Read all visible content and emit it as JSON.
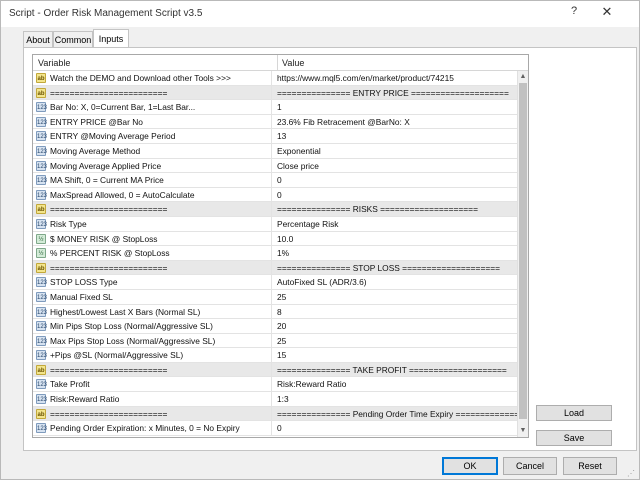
{
  "window": {
    "title": "Script - Order Risk Management Script v3.5",
    "help_glyph": "?",
    "close_glyph": "✕"
  },
  "tabs": [
    {
      "label": "About",
      "active": false
    },
    {
      "label": "Common",
      "active": false
    },
    {
      "label": "Inputs",
      "active": true
    }
  ],
  "grid": {
    "headers": {
      "variable": "Variable",
      "value": "Value"
    },
    "rows": [
      {
        "icon": "ab",
        "variable": "Watch the DEMO and Download other Tools >>>",
        "value": "https://www.mql5.com/en/market/product/74215",
        "sep": false
      },
      {
        "icon": "ab",
        "variable": "========================",
        "value": "=============== ENTRY PRICE ====================",
        "sep": true
      },
      {
        "icon": "123",
        "variable": "Bar No: X, 0=Current Bar, 1=Last Bar...",
        "value": "1",
        "sep": false
      },
      {
        "icon": "123",
        "variable": "ENTRY PRICE @Bar No",
        "value": "23.6% Fib Retracement @BarNo: X",
        "sep": false
      },
      {
        "icon": "123",
        "variable": "ENTRY @Moving Average Period",
        "value": "13",
        "sep": false
      },
      {
        "icon": "123",
        "variable": "Moving Average Method",
        "value": "Exponential",
        "sep": false
      },
      {
        "icon": "123",
        "variable": "Moving Average Applied Price",
        "value": "Close price",
        "sep": false
      },
      {
        "icon": "123",
        "variable": "MA Shift, 0 = Current MA Price",
        "value": "0",
        "sep": false
      },
      {
        "icon": "123",
        "variable": "MaxSpread Allowed, 0 = AutoCalculate",
        "value": "0",
        "sep": false
      },
      {
        "icon": "ab",
        "variable": "========================",
        "value": "=============== RISKS ====================",
        "sep": true
      },
      {
        "icon": "123",
        "variable": "Risk Type",
        "value": "Percentage Risk",
        "sep": false
      },
      {
        "icon": "half",
        "variable": "$ MONEY RISK @ StopLoss",
        "value": "10.0",
        "sep": false
      },
      {
        "icon": "half",
        "variable": "% PERCENT RISK @ StopLoss",
        "value": "1%",
        "sep": false
      },
      {
        "icon": "ab",
        "variable": "========================",
        "value": "=============== STOP LOSS ====================",
        "sep": true
      },
      {
        "icon": "123",
        "variable": "STOP LOSS Type",
        "value": "AutoFixed SL (ADR/3.6)",
        "sep": false
      },
      {
        "icon": "123",
        "variable": "Manual Fixed SL",
        "value": "25",
        "sep": false
      },
      {
        "icon": "123",
        "variable": "Highest/Lowest Last X Bars (Normal SL)",
        "value": "8",
        "sep": false
      },
      {
        "icon": "123",
        "variable": "Min Pips Stop Loss (Normal/Aggressive SL)",
        "value": "20",
        "sep": false
      },
      {
        "icon": "123",
        "variable": "Max Pips Stop Loss (Normal/Aggressive SL)",
        "value": "25",
        "sep": false
      },
      {
        "icon": "123",
        "variable": "+Pips @SL (Normal/Aggressive SL)",
        "value": "15",
        "sep": false
      },
      {
        "icon": "ab",
        "variable": "========================",
        "value": "=============== TAKE PROFIT ====================",
        "sep": true
      },
      {
        "icon": "123",
        "variable": "Take Profit",
        "value": "Risk:Reward Ratio",
        "sep": false
      },
      {
        "icon": "123",
        "variable": "Risk:Reward Ratio",
        "value": "1:3",
        "sep": false
      },
      {
        "icon": "ab",
        "variable": "========================",
        "value": "=============== Pending Order Time Expiry ===============...",
        "sep": true
      },
      {
        "icon": "123",
        "variable": "Pending Order Expiration: x Minutes, 0 = No Expiry",
        "value": "0",
        "sep": false
      }
    ]
  },
  "icons": {
    "ab": "ab",
    "123": "123",
    "half": "½"
  },
  "scroll": {
    "up_glyph": "▲",
    "down_glyph": "▼"
  },
  "side_buttons": {
    "load": "Load",
    "save": "Save"
  },
  "bottom_buttons": {
    "ok": "OK",
    "cancel": "Cancel",
    "reset": "Reset"
  },
  "colors": {
    "accent": "#0078d7",
    "separator_row": "#e8e8e8"
  }
}
